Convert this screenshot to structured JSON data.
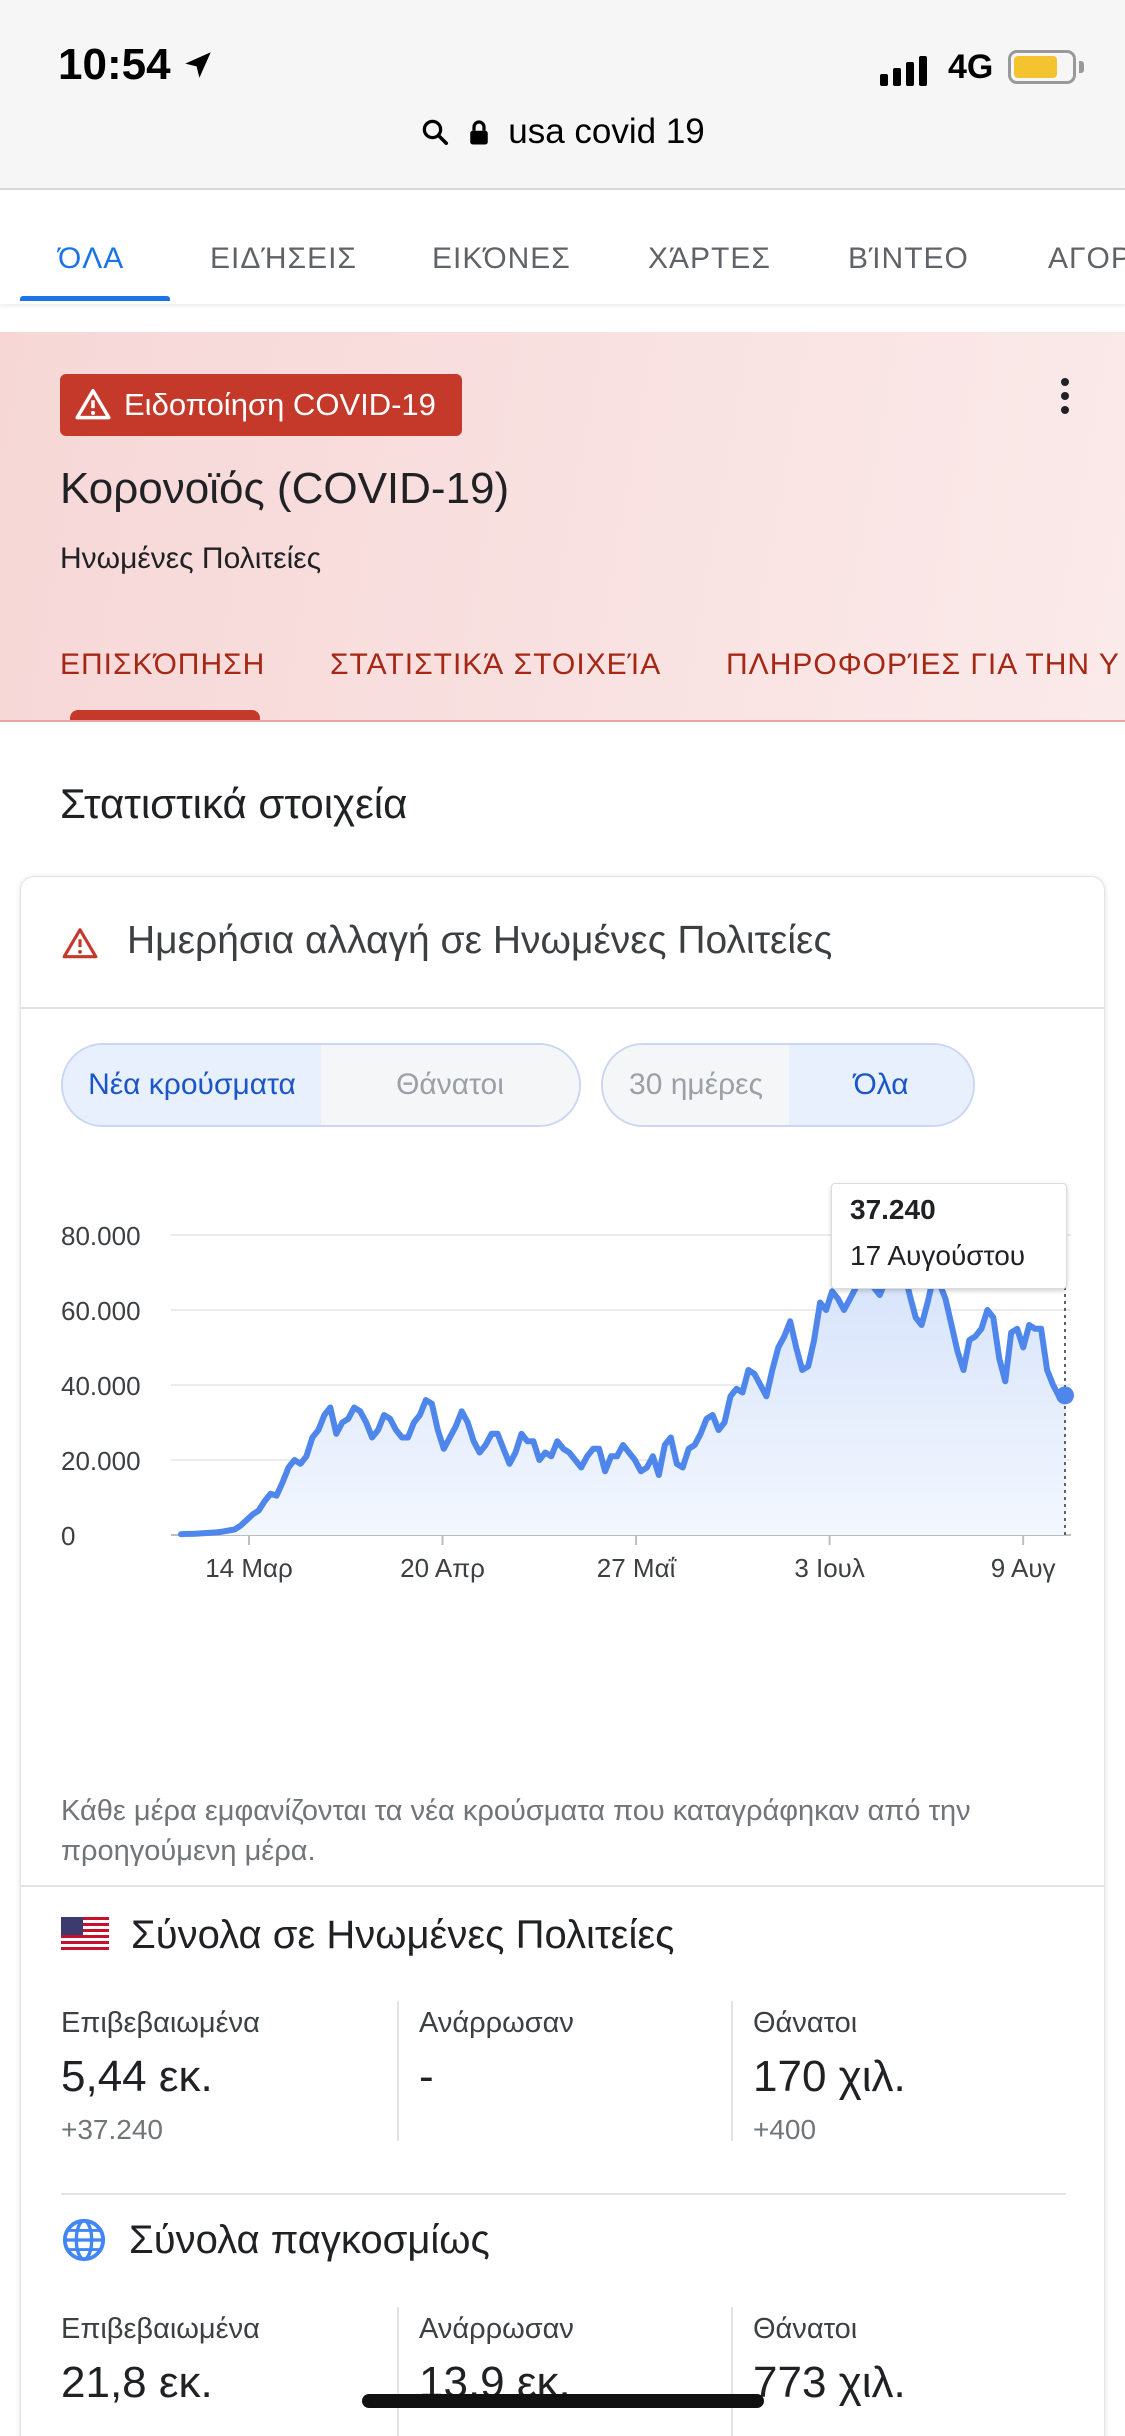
{
  "status_bar": {
    "time": "10:54",
    "network": "4G",
    "battery_level": 0.76
  },
  "browser": {
    "url": "usa covid 19"
  },
  "search_tabs": [
    {
      "label": "ΌΛΑ",
      "active": true
    },
    {
      "label": "ΕΙΔΉΣΕΙΣ",
      "active": false
    },
    {
      "label": "ΕΙΚΌΝΕΣ",
      "active": false
    },
    {
      "label": "ΧΆΡΤΕΣ",
      "active": false
    },
    {
      "label": "ΒΊΝΤΕΟ",
      "active": false
    },
    {
      "label": "ΑΓΟΡ",
      "active": false
    }
  ],
  "covid_panel": {
    "alert_label": "Ειδοποίηση COVID-19",
    "title": "Κορονοϊός (COVID-19)",
    "subtitle": "Ηνωμένες Πολιτείες",
    "tabs": [
      {
        "label": "ΕΠΙΣΚΌΠΗΣΗ",
        "active": true
      },
      {
        "label": "ΣΤΑΤΙΣΤΙΚΆ ΣΤΟΙΧΕΊΑ",
        "active": false
      },
      {
        "label": "ΠΛΗΡΟΦΟΡΊΕΣ ΓΙΑ ΤΗΝ Υ",
        "active": false
      }
    ]
  },
  "stats": {
    "section_title": "Στατιστικά στοιχεία",
    "card_title": "Ημερήσια αλλαγή σε Ηνωμένες Πολιτείες",
    "metric_toggle": [
      {
        "label": "Νέα κρούσματα",
        "selected": true
      },
      {
        "label": "Θάνατοι",
        "selected": false
      }
    ],
    "range_toggle": [
      {
        "label": "30 ημέρες",
        "selected": false
      },
      {
        "label": "Όλα",
        "selected": true
      }
    ],
    "tooltip": {
      "value": "37.240",
      "date": "17 Αυγούστου"
    },
    "note": "Κάθε μέρα εμφανίζονται τα νέα κρούσματα που καταγράφηκαν από την προηγούμενη μέρα."
  },
  "chart_data": {
    "type": "area",
    "title": "",
    "xlabel": "",
    "ylabel": "",
    "ylim": [
      0,
      80000
    ],
    "y_ticks": [
      "0",
      "20.000",
      "40.000",
      "60.000",
      "80.000"
    ],
    "y_tick_values": [
      0,
      20000,
      40000,
      60000,
      80000
    ],
    "x_ticks": [
      "14 Μαρ",
      "20 Απρ",
      "27 Μαΐ",
      "3 Ιουλ",
      "9 Αυγ"
    ],
    "x_tick_days": [
      13,
      50,
      87,
      124,
      161
    ],
    "x_start_day": 0,
    "x_end_day": 169,
    "grid": true,
    "color": "#4f86ec",
    "highlight": {
      "day": 169,
      "value": 37240,
      "label": "17 Αυγούστου"
    },
    "series": [
      {
        "values": [
          200,
          300,
          300,
          400,
          500,
          600,
          700,
          900,
          1200,
          1500,
          2500,
          4000,
          5500,
          6500,
          9000,
          11000,
          10500,
          14000,
          18000,
          20000,
          19000,
          21000,
          26000,
          28000,
          32000,
          34000,
          27000,
          30000,
          31000,
          34000,
          33000,
          30000,
          26000,
          28000,
          32000,
          31000,
          28000,
          26000,
          26000,
          30000,
          32000,
          36000,
          35000,
          28000,
          23000,
          26000,
          29000,
          33000,
          30000,
          25000,
          22000,
          24000,
          27000,
          27000,
          23000,
          19000,
          22000,
          27000,
          25000,
          25000,
          20000,
          22000,
          21000,
          25000,
          23000,
          22000,
          20000,
          18000,
          21000,
          23000,
          23000,
          17000,
          21000,
          21000,
          24000,
          22000,
          20000,
          17000,
          18000,
          21000,
          16000,
          24000,
          26000,
          19000,
          18000,
          23000,
          24000,
          27000,
          31000,
          32000,
          28000,
          30000,
          37000,
          39000,
          38000,
          44000,
          43000,
          40000,
          37000,
          44000,
          50000,
          53000,
          57000,
          50000,
          44000,
          45000,
          52000,
          62000,
          60000,
          65000,
          63000,
          60000,
          63000,
          66000,
          70000,
          71000,
          66000,
          64000,
          68000,
          71000,
          72000,
          71000,
          64000,
          58000,
          56000,
          62000,
          69000,
          67000,
          63000,
          56000,
          49000,
          44000,
          52000,
          53000,
          55000,
          60000,
          58000,
          47000,
          41000,
          54000,
          55000,
          50000,
          56000,
          55000,
          55000,
          44000,
          40000,
          37000,
          37240
        ]
      }
    ]
  },
  "us_totals": {
    "heading": "Σύνολα σε Ηνωμένες Πολιτείες",
    "columns": [
      {
        "label": "Επιβεβαιωμένα",
        "value": "5,44 εκ.",
        "delta": "+37.240"
      },
      {
        "label": "Ανάρρωσαν",
        "value": "-",
        "delta": ""
      },
      {
        "label": "Θάνατοι",
        "value": "170 χιλ.",
        "delta": "+400"
      }
    ]
  },
  "world_totals": {
    "heading": "Σύνολα παγκοσμίως",
    "columns": [
      {
        "label": "Επιβεβαιωμένα",
        "value": "21,8 εκ."
      },
      {
        "label": "Ανάρρωσαν",
        "value": "13,9 εκ."
      },
      {
        "label": "Θάνατοι",
        "value": "773 χιλ."
      }
    ]
  }
}
